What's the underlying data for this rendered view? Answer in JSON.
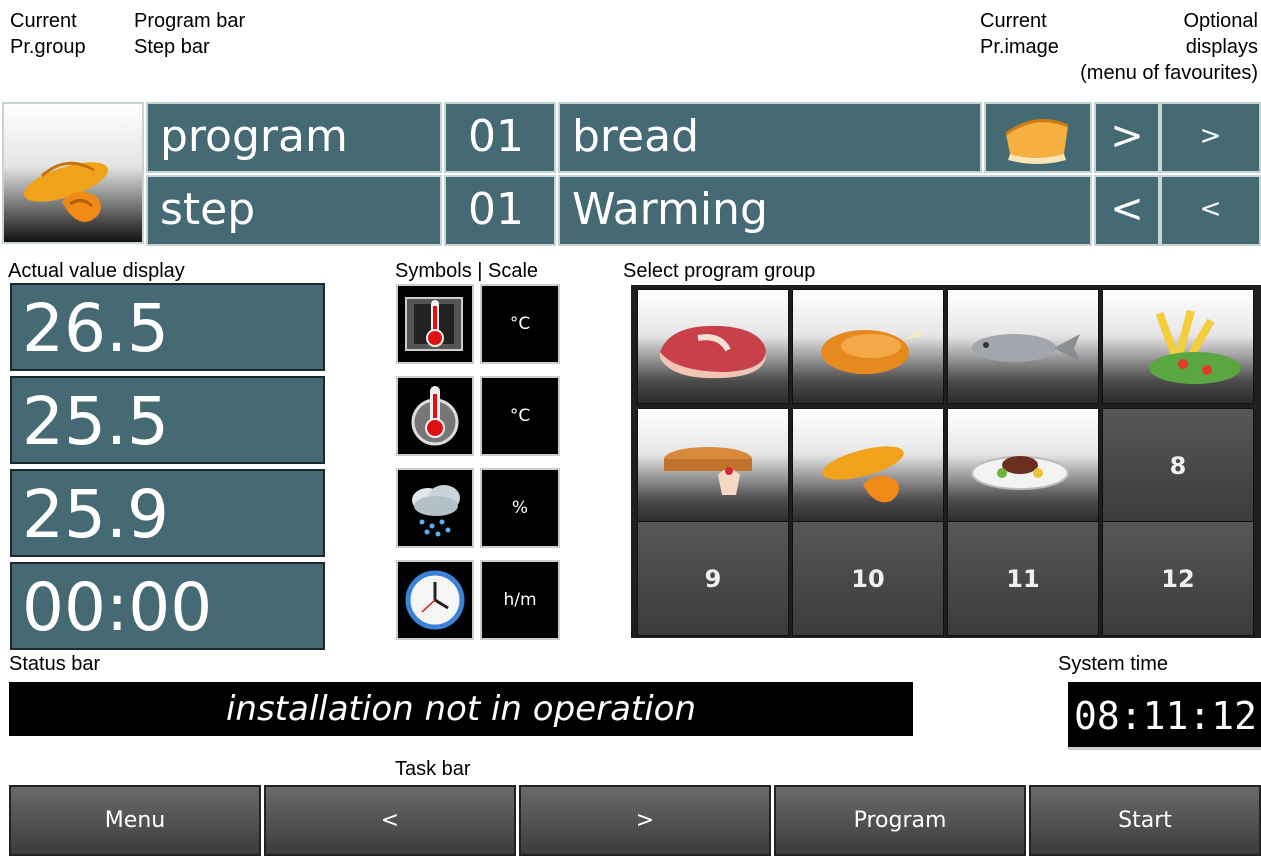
{
  "annotations": {
    "current_group_line1": "Current",
    "current_group_line2": "Pr.group",
    "program_bar": "Program bar",
    "step_bar": "Step bar",
    "current_image_line1": "Current",
    "current_image_line2": "Pr.image",
    "optional_line1": "Optional",
    "optional_line2": "displays",
    "optional_line3": "(menu of favourites)",
    "actual_value_display": "Actual value display",
    "symbols_scale": "Symbols | Scale",
    "select_program_group": "Select program group",
    "status_bar": "Status bar",
    "system_time": "System time",
    "task_bar": "Task bar"
  },
  "program_bar": {
    "label": "program",
    "number": "01",
    "name": "bread",
    "next_label": ">",
    "next_small": ">"
  },
  "step_bar": {
    "label": "step",
    "number": "01",
    "name": "Warming",
    "prev_label": "<",
    "prev_small": "<"
  },
  "actual_values": [
    "26.5",
    "25.5",
    "25.9",
    "00:00"
  ],
  "symbols": [
    "oven-temperature-icon",
    "core-temperature-icon",
    "humidity-icon",
    "clock-icon"
  ],
  "scales": [
    "°C",
    "°C",
    "%",
    "h/m"
  ],
  "program_groups": {
    "images": [
      "steak-icon",
      "chicken-icon",
      "fish-icon",
      "fries-icon",
      "pie-icon",
      "bread-icon",
      "plate-icon"
    ],
    "numbers": [
      "8",
      "9",
      "10",
      "11",
      "12"
    ]
  },
  "status": "installation not in operation",
  "system_time": "08:11:12",
  "taskbar": [
    "Menu",
    "<",
    ">",
    "Program",
    "Start"
  ],
  "colors": {
    "bar": "#456a74",
    "status_bg": "#000000"
  }
}
